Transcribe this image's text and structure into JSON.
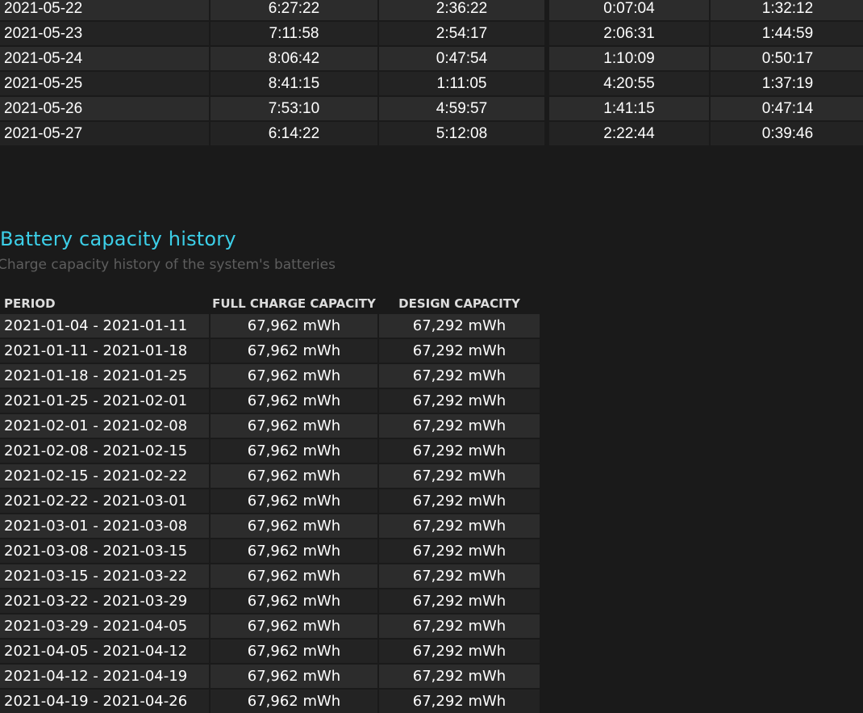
{
  "usage_rows": [
    {
      "date": "2021-05-22",
      "c1": "6:27:22",
      "c2": "2:36:22",
      "c3": "0:07:04",
      "c4": "1:32:12"
    },
    {
      "date": "2021-05-23",
      "c1": "7:11:58",
      "c2": "2:54:17",
      "c3": "2:06:31",
      "c4": "1:44:59"
    },
    {
      "date": "2021-05-24",
      "c1": "8:06:42",
      "c2": "0:47:54",
      "c3": "1:10:09",
      "c4": "0:50:17"
    },
    {
      "date": "2021-05-25",
      "c1": "8:41:15",
      "c2": "1:11:05",
      "c3": "4:20:55",
      "c4": "1:37:19"
    },
    {
      "date": "2021-05-26",
      "c1": "7:53:10",
      "c2": "4:59:57",
      "c3": "1:41:15",
      "c4": "0:47:14"
    },
    {
      "date": "2021-05-27",
      "c1": "6:14:22",
      "c2": "5:12:08",
      "c3": "2:22:44",
      "c4": "0:39:46"
    }
  ],
  "capacity": {
    "title": "Battery capacity history",
    "subtitle": "Charge capacity history of the system's batteries",
    "headers": {
      "period": "PERIOD",
      "full_charge": "FULL CHARGE CAPACITY",
      "design": "DESIGN CAPACITY"
    },
    "rows": [
      {
        "period": "2021-01-04 - 2021-01-11",
        "full": "67,962 mWh",
        "design": "67,292 mWh"
      },
      {
        "period": "2021-01-11 - 2021-01-18",
        "full": "67,962 mWh",
        "design": "67,292 mWh"
      },
      {
        "period": "2021-01-18 - 2021-01-25",
        "full": "67,962 mWh",
        "design": "67,292 mWh"
      },
      {
        "period": "2021-01-25 - 2021-02-01",
        "full": "67,962 mWh",
        "design": "67,292 mWh"
      },
      {
        "period": "2021-02-01 - 2021-02-08",
        "full": "67,962 mWh",
        "design": "67,292 mWh"
      },
      {
        "period": "2021-02-08 - 2021-02-15",
        "full": "67,962 mWh",
        "design": "67,292 mWh"
      },
      {
        "period": "2021-02-15 - 2021-02-22",
        "full": "67,962 mWh",
        "design": "67,292 mWh"
      },
      {
        "period": "2021-02-22 - 2021-03-01",
        "full": "67,962 mWh",
        "design": "67,292 mWh"
      },
      {
        "period": "2021-03-01 - 2021-03-08",
        "full": "67,962 mWh",
        "design": "67,292 mWh"
      },
      {
        "period": "2021-03-08 - 2021-03-15",
        "full": "67,962 mWh",
        "design": "67,292 mWh"
      },
      {
        "period": "2021-03-15 - 2021-03-22",
        "full": "67,962 mWh",
        "design": "67,292 mWh"
      },
      {
        "period": "2021-03-22 - 2021-03-29",
        "full": "67,962 mWh",
        "design": "67,292 mWh"
      },
      {
        "period": "2021-03-29 - 2021-04-05",
        "full": "67,962 mWh",
        "design": "67,292 mWh"
      },
      {
        "period": "2021-04-05 - 2021-04-12",
        "full": "67,962 mWh",
        "design": "67,292 mWh"
      },
      {
        "period": "2021-04-12 - 2021-04-19",
        "full": "67,962 mWh",
        "design": "67,292 mWh"
      },
      {
        "period": "2021-04-19 - 2021-04-26",
        "full": "67,962 mWh",
        "design": "67,292 mWh"
      }
    ]
  }
}
